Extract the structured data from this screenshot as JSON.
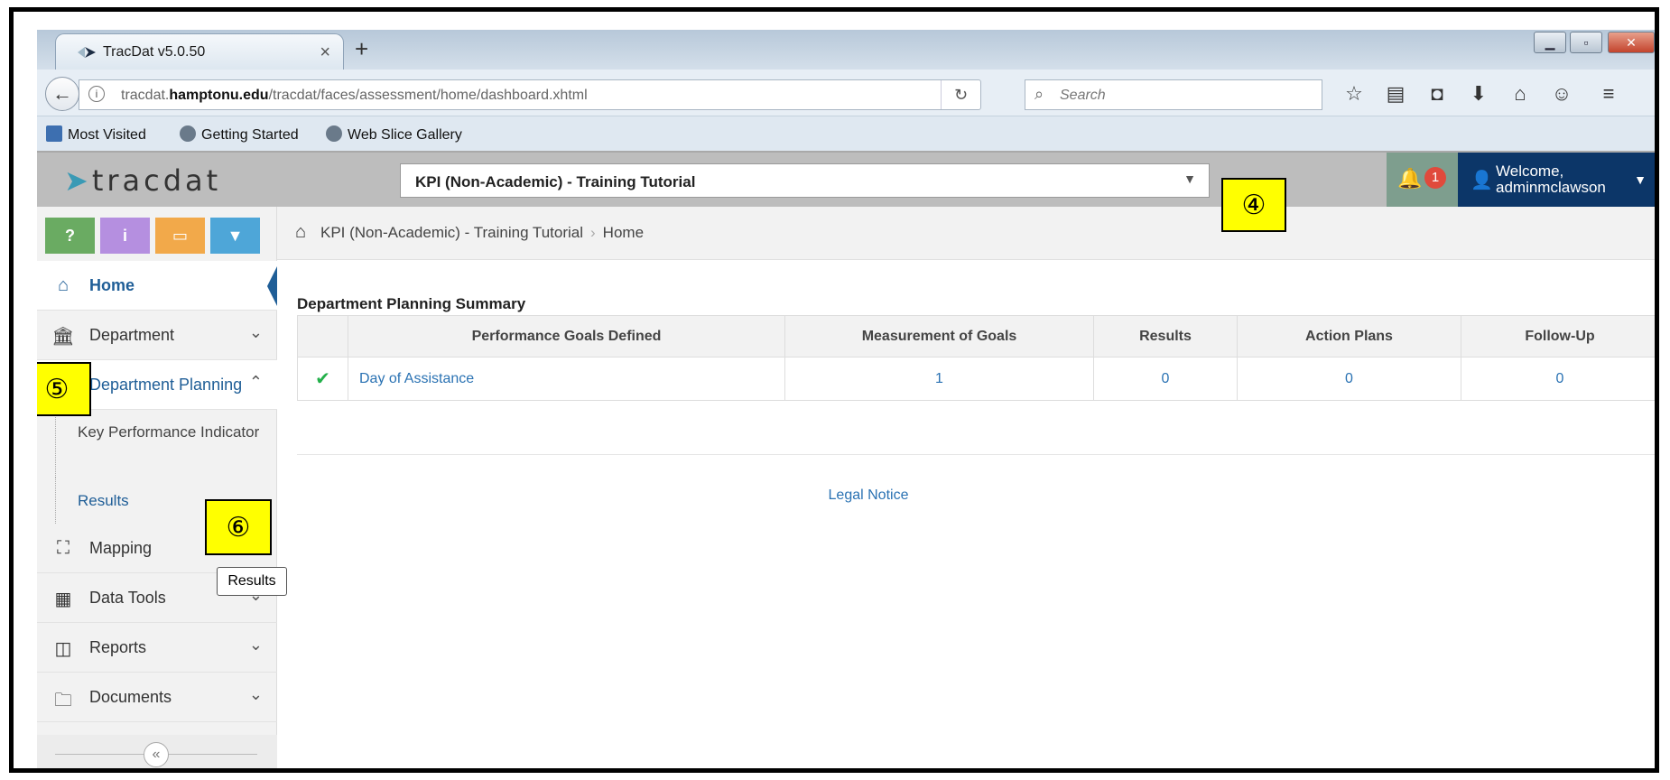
{
  "browser": {
    "tab_title": "TracDat v5.0.50",
    "new_tab": "+",
    "tab_close": "×",
    "url_prefix": "tracdat.",
    "url_domain": "hamptonu.edu",
    "url_path": "/tracdat/faces/assessment/home/dashboard.xhtml",
    "search_placeholder": "Search",
    "bookmarks": [
      "Most Visited",
      "Getting Started",
      "Web Slice Gallery"
    ]
  },
  "app": {
    "logo": "tracdat",
    "unit_selector": "KPI (Non-Academic) - Training Tutorial",
    "notification_count": "1",
    "welcome_line1": "Welcome,",
    "welcome_line2": "adminmclawson"
  },
  "quick_buttons": [
    {
      "label": "?",
      "color": "#6aab62"
    },
    {
      "label": "i",
      "color": "#b58fe0"
    },
    {
      "label": "▭",
      "color": "#f2a94a"
    },
    {
      "label": "▼",
      "color": "#4ea6d8"
    }
  ],
  "sidebar": {
    "items": [
      {
        "label": "Home",
        "icon": "home-icon"
      },
      {
        "label": "Department",
        "icon": "bank-icon"
      },
      {
        "label": "Department Planning",
        "icon": "planning-icon"
      },
      {
        "label": "Mapping",
        "icon": "sitemap-icon"
      },
      {
        "label": "Data Tools",
        "icon": "table-icon"
      },
      {
        "label": "Reports",
        "icon": "columns-icon"
      },
      {
        "label": "Documents",
        "icon": "folder-icon"
      }
    ],
    "sub_items": [
      "Key Performance Indicator",
      "Results"
    ]
  },
  "breadcrumb": {
    "unit": "KPI (Non-Academic) - Training Tutorial",
    "page": "Home"
  },
  "summary": {
    "title": "Department Planning Summary",
    "headers": [
      "Performance Goals Defined",
      "Measurement of Goals",
      "Results",
      "Action Plans",
      "Follow-Up"
    ],
    "rows": [
      {
        "name": "Day of Assistance",
        "measurement": "1",
        "results": "0",
        "action_plans": "0",
        "follow_up": "0"
      }
    ]
  },
  "footer": {
    "legal": "Legal Notice"
  },
  "annotations": {
    "c4": "④",
    "c5": "⑤",
    "c6": "⑥",
    "tooltip": "Results"
  }
}
